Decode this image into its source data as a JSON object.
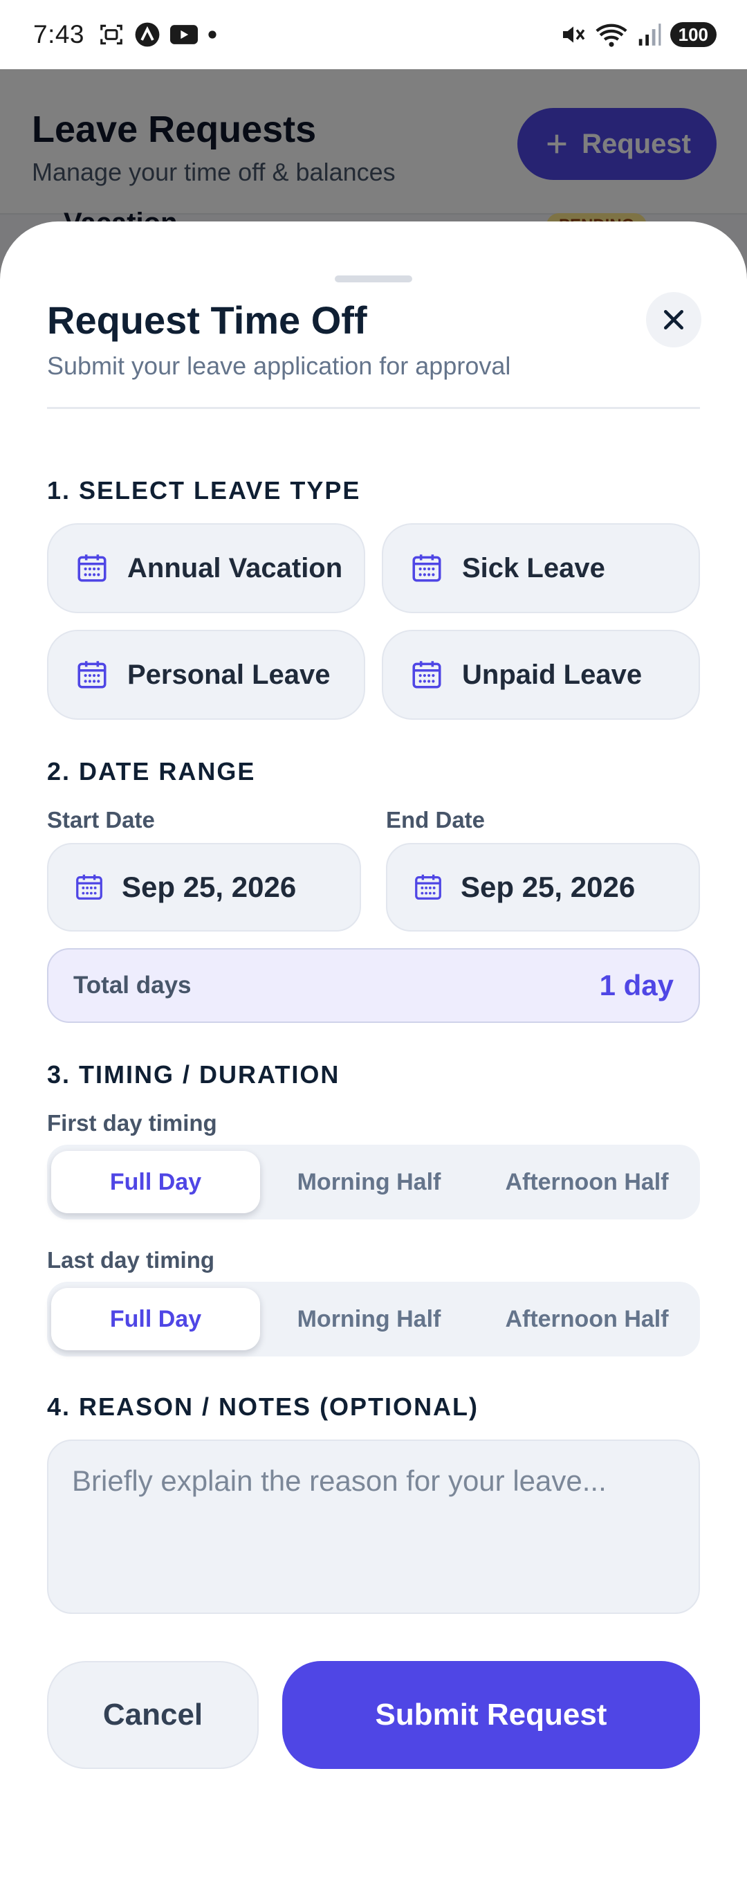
{
  "status_bar": {
    "time": "7:43",
    "battery": "100"
  },
  "background": {
    "title": "Leave Requests",
    "subtitle": "Manage your time off & balances",
    "request_button": "Request",
    "peek_card_title": "Vacation",
    "peek_badge": "PENDING"
  },
  "sheet": {
    "title": "Request Time Off",
    "subtitle": "Submit your leave application for approval",
    "section_leave_type": "1. SELECT LEAVE TYPE",
    "leave_types": [
      {
        "label": "Annual Vacation",
        "icon": "calendar-icon"
      },
      {
        "label": "Sick Leave",
        "icon": "calendar-icon"
      },
      {
        "label": "Personal Leave",
        "icon": "calendar-icon"
      },
      {
        "label": "Unpaid Leave",
        "icon": "calendar-icon"
      }
    ],
    "section_date_range": "2. DATE RANGE",
    "start_date_label": "Start Date",
    "start_date": "Sep 25, 2026",
    "end_date_label": "End Date",
    "end_date": "Sep 25, 2026",
    "total_days_label": "Total days",
    "total_days_value": "1 day",
    "section_timing": "3. TIMING / DURATION",
    "first_day_label": "First day timing",
    "last_day_label": "Last day timing",
    "timing_options": [
      "Full Day",
      "Morning Half",
      "Afternoon Half"
    ],
    "first_day_selected": "Full Day",
    "last_day_selected": "Full Day",
    "section_reason": "4. REASON / NOTES (OPTIONAL)",
    "reason_placeholder": "Briefly explain the reason for your leave...",
    "cancel_label": "Cancel",
    "submit_label": "Submit Request"
  },
  "colors": {
    "accent": "#4f46e5",
    "surface": "#eff2f7",
    "text_dark": "#0f1f33",
    "total_bg": "#eeedfd"
  }
}
